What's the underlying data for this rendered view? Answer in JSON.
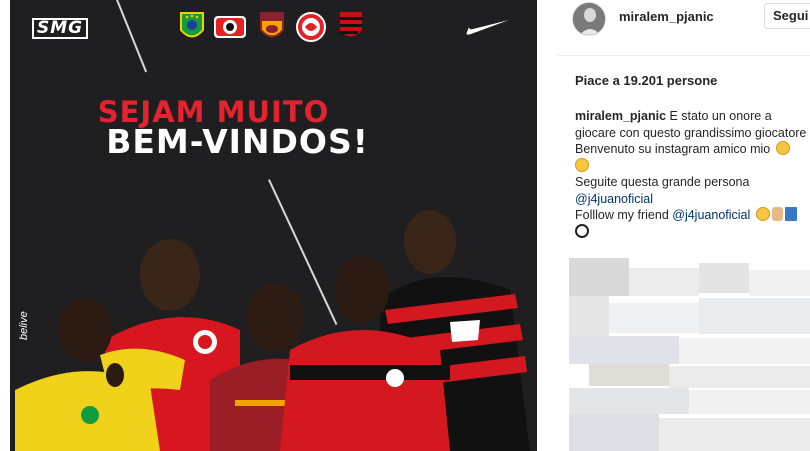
{
  "post": {
    "image": {
      "brand_logo": "SMG",
      "headline_line1": "SEJAM MUITO",
      "headline_line2": "BEM-VINDOS!",
      "credit": "belive",
      "club_icons": [
        "brazil-crest-icon",
        "leverkusen-crest-icon",
        "roma-crest-icon",
        "internacional-crest-icon",
        "flamengo-crest-icon"
      ],
      "sponsor_icon": "nike-swoosh-icon",
      "colors": {
        "background": "#1f1f21",
        "headline_red": "#e3232e",
        "headline_white": "#ffffff"
      }
    }
  },
  "side": {
    "header": {
      "username": "miralem_pjanic",
      "follow_label": "Segui"
    },
    "likes_text": "Piace a 19.201 persone",
    "caption": {
      "username": "miralem_pjanic",
      "line1": "E stato un onore a giocare con questo grandissimo giocatore !",
      "line2": "Benvenuto su instagram amico mio",
      "line3": "Seguite questa grande persona",
      "mention1": "@j4juanoficial",
      "line4": "Folllow my friend",
      "mention2": "@j4juanoficial"
    },
    "colors": {
      "link": "#003569",
      "text": "#262626",
      "border": "#dbdbdb"
    }
  }
}
